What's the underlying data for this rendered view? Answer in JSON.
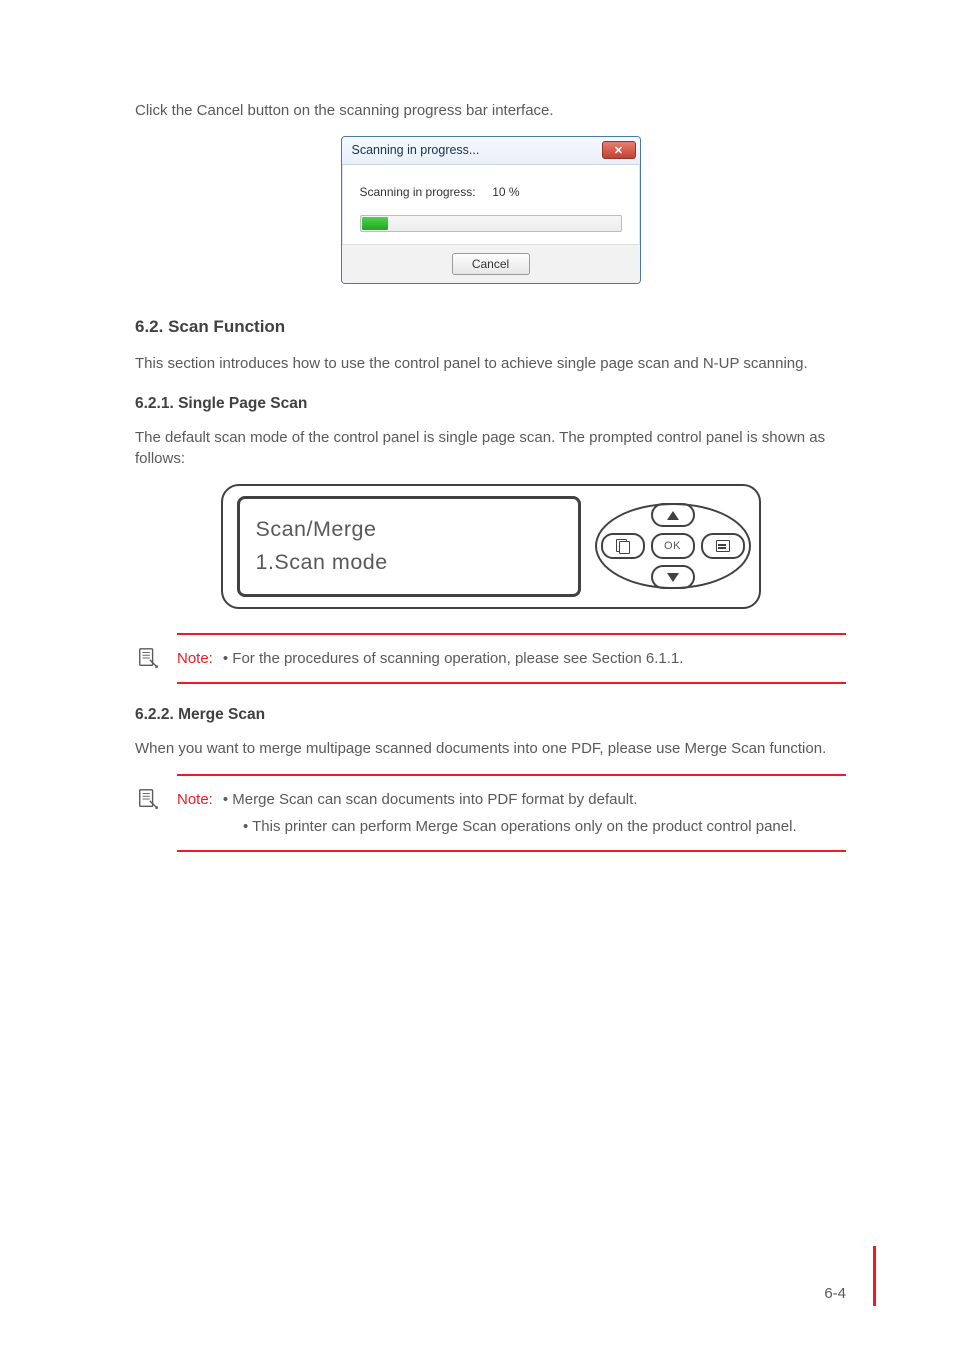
{
  "intro_para": "Click the Cancel button on the scanning progress bar interface.",
  "dialog": {
    "title": "Scanning in progress...",
    "label": "Scanning in progress:     10 %",
    "cancel": "Cancel",
    "progress_percent": 10
  },
  "section62": {
    "heading": "6.2. Scan Function",
    "para": "This section introduces how to use the control panel to achieve single page scan and N-UP scanning."
  },
  "section621": {
    "heading": "6.2.1. Single Page Scan",
    "para": "The default scan mode of the control panel is single page scan. The prompted control panel is shown as follows:"
  },
  "lcd": {
    "line1": "Scan/Merge",
    "line2": "1.Scan mode",
    "ok": "OK"
  },
  "note1": {
    "label": "Note:",
    "text": "• For the procedures of scanning operation, please see Section 6.1.1."
  },
  "section622": {
    "heading": "6.2.2. Merge Scan",
    "para": "When you want to merge multipage scanned documents into one PDF, please use Merge Scan function."
  },
  "note2": {
    "label": "Note:",
    "line1": "• Merge Scan can scan documents into PDF format by default.",
    "line2": "• This printer can perform Merge Scan operations only on the product control panel."
  },
  "page_number": "6-4"
}
